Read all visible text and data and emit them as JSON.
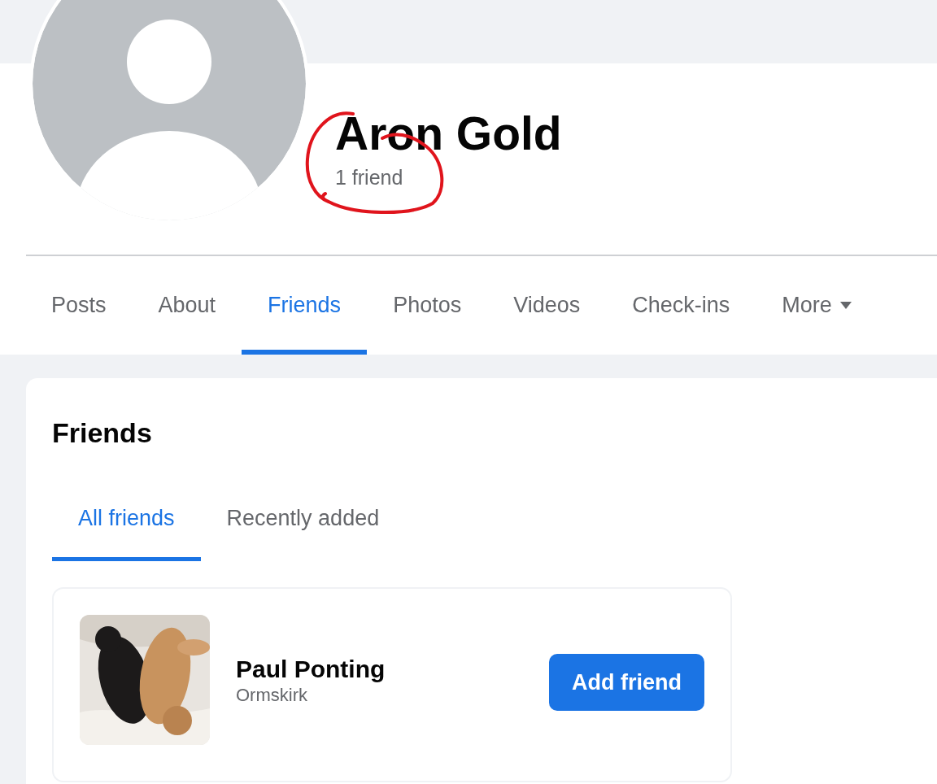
{
  "profile": {
    "name": "Aron Gold",
    "friend_count": "1 friend"
  },
  "tabs": [
    {
      "label": "Posts",
      "selected": false,
      "has_menu": false
    },
    {
      "label": "About",
      "selected": false,
      "has_menu": false
    },
    {
      "label": "Friends",
      "selected": true,
      "has_menu": false
    },
    {
      "label": "Photos",
      "selected": false,
      "has_menu": false
    },
    {
      "label": "Videos",
      "selected": false,
      "has_menu": false
    },
    {
      "label": "Check-ins",
      "selected": false,
      "has_menu": false
    },
    {
      "label": "More",
      "selected": false,
      "has_menu": true
    }
  ],
  "friends_section": {
    "title": "Friends",
    "tabs": [
      {
        "label": "All friends",
        "selected": true
      },
      {
        "label": "Recently added",
        "selected": false
      }
    ],
    "friends": [
      {
        "name": "Paul Ponting",
        "location": "Ormskirk",
        "action": "Add friend"
      }
    ]
  }
}
